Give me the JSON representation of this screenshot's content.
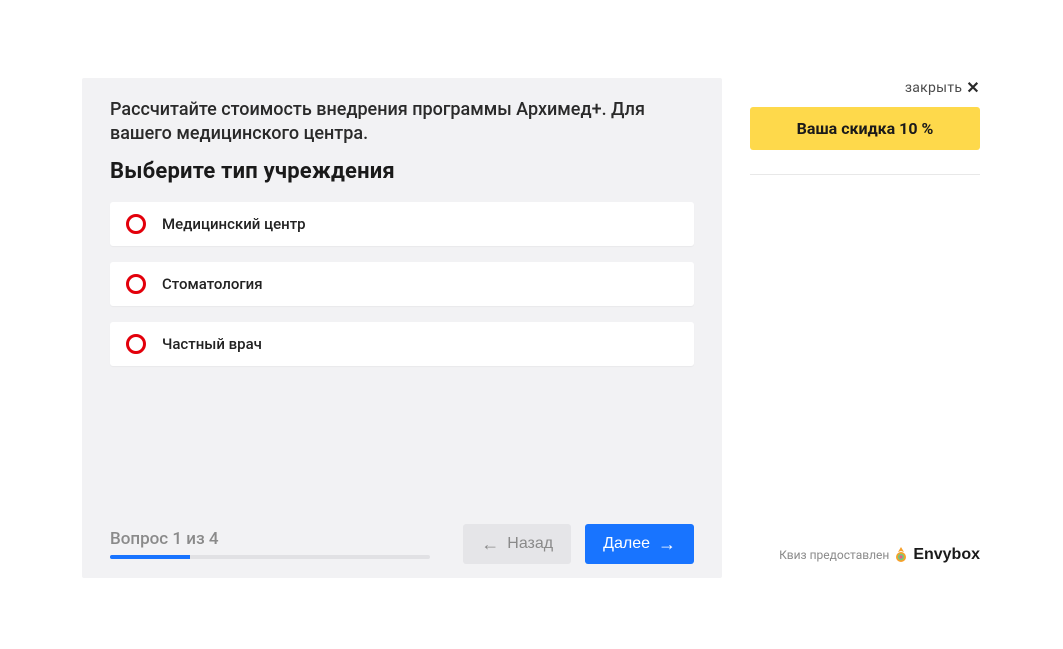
{
  "quiz": {
    "intro": "Рассчитайте стоимость внедрения программы Архимед+. Для вашего медицинского центра.",
    "question_title": "Выберите тип учреждения",
    "options": [
      {
        "label": "Медицинский центр"
      },
      {
        "label": "Стоматология"
      },
      {
        "label": "Частный врач"
      }
    ],
    "progress_text": "Вопрос 1 из 4",
    "progress_percent": 25,
    "back_label": "Назад",
    "next_label": "Далее"
  },
  "sidebar": {
    "close_label": "закрыть",
    "discount_label": "Ваша скидка 10 %"
  },
  "provider": {
    "prefix": "Квиз предоставлен",
    "brand": "Envybox"
  }
}
